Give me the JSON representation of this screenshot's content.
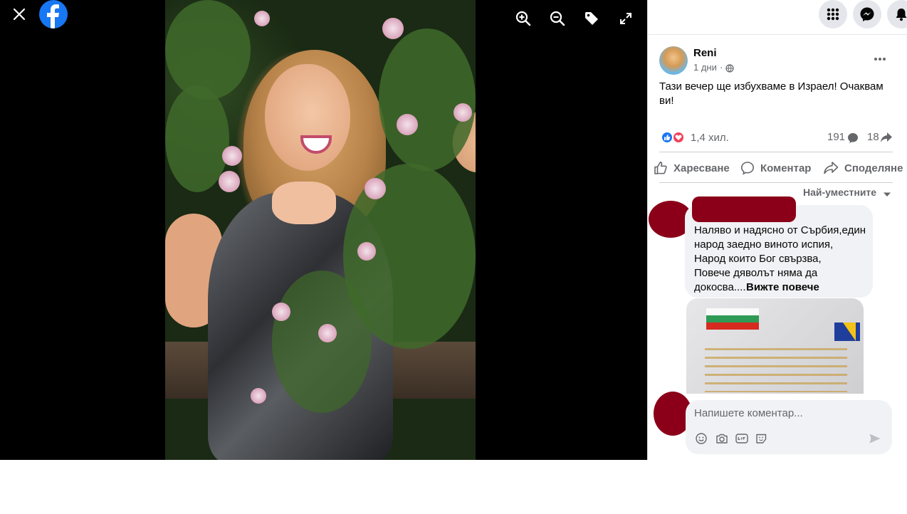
{
  "viewer": {
    "close_icon": "close-icon",
    "logo_icon": "facebook-logo-icon",
    "tools": [
      "zoom-in-icon",
      "zoom-out-icon",
      "tag-icon",
      "fullscreen-icon"
    ]
  },
  "topbar": {
    "icons": [
      "menu-grid-icon",
      "messenger-icon",
      "bell-icon"
    ]
  },
  "post": {
    "author": "Reni",
    "time": "1 дни",
    "privacy_separator": "·",
    "text_line1": "Тази вечер ще избухваме в Израел! Очаквам",
    "text_line2": "ви!",
    "reactions_count": "1,4 хил.",
    "comments_count": "191",
    "shares_count": "18"
  },
  "actions": {
    "like": "Харесване",
    "comment": "Коментар",
    "share": "Споделяне"
  },
  "comments": {
    "sort_label": "Най-уместните",
    "first": {
      "line1": "Наляво и надясно от Сърбия,един",
      "line2": "народ заедно виното испия,",
      "line3": "Народ които Бог свързва,",
      "line4": "Повече дяволът няма да",
      "line5": "докосва....",
      "see_more": "Вижте повече"
    }
  },
  "composer": {
    "placeholder": "Напишете коментар..."
  },
  "colors": {
    "facebook_blue": "#1877f2",
    "like_blue": "#1877f2",
    "love_red": "#f33e58",
    "redaction": "#8b0018"
  }
}
